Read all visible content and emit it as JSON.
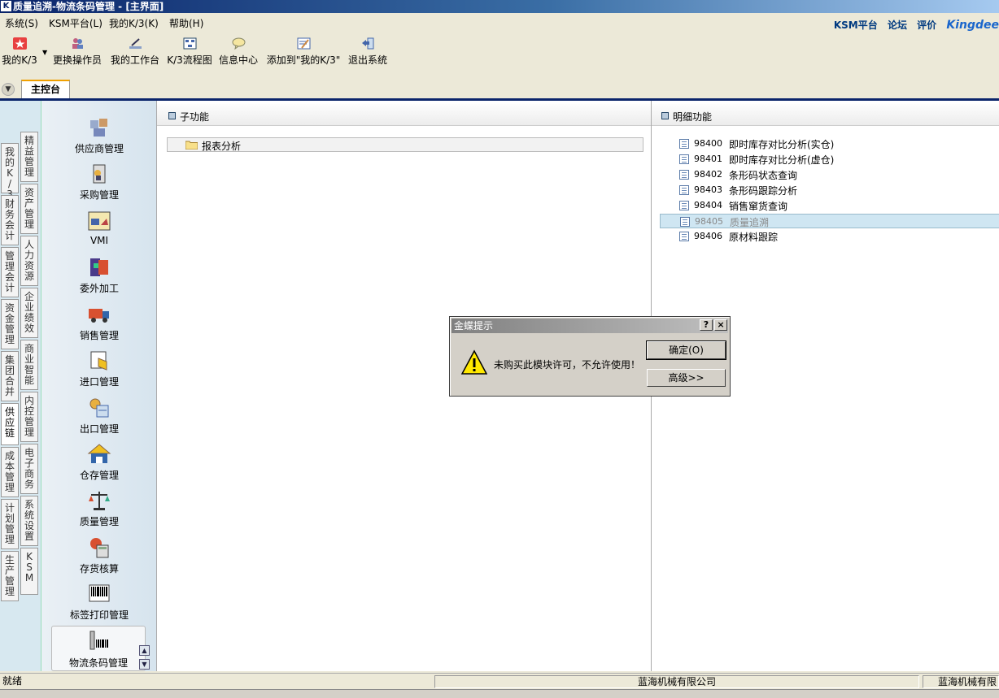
{
  "window": {
    "title": "质量追溯-物流条码管理 - [主界面]",
    "icon": "K"
  },
  "menu": {
    "items": [
      "系统(S)",
      "KSM平台(L)",
      "我的K/3(K)",
      "帮助(H)"
    ],
    "right": {
      "ksm": "KSM平台",
      "forum": "论坛",
      "rating": "评价",
      "brand": "Kingdee"
    }
  },
  "toolbar": {
    "items": [
      {
        "label": "我的K/3",
        "icon": "star-icon"
      },
      {
        "label": "更换操作员",
        "icon": "users-icon"
      },
      {
        "label": "我的工作台",
        "icon": "pen-icon"
      },
      {
        "label": "K/3流程图",
        "icon": "flowchart-icon"
      },
      {
        "label": "信息中心",
        "icon": "message-icon"
      },
      {
        "label": "添加到\"我的K/3\"",
        "icon": "add-favorite-icon"
      },
      {
        "label": "退出系统",
        "icon": "exit-icon"
      }
    ]
  },
  "tabs": {
    "main": "主控台"
  },
  "side_tabs": {
    "outer": [
      "我的K/3",
      "财务会计",
      "管理会计",
      "资金管理",
      "集团合并",
      "供应链",
      "成本管理",
      "计划管理",
      "生产管理"
    ],
    "inner": [
      "精益管理",
      "资产管理",
      "人力资源",
      "企业绩效",
      "商业智能",
      "内控管理",
      "电子商务",
      "系统设置",
      "KSM"
    ]
  },
  "modules": [
    "供应商管理",
    "采购管理",
    "VMI",
    "委外加工",
    "销售管理",
    "进口管理",
    "出口管理",
    "仓存管理",
    "质量管理",
    "存货核算",
    "标签打印管理",
    "物流条码管理"
  ],
  "sub_panel": {
    "header": "子功能",
    "folder": "报表分析"
  },
  "detail_panel": {
    "header": "明细功能",
    "items": [
      {
        "code": "98400",
        "name": "即时库存对比分析(实仓)"
      },
      {
        "code": "98401",
        "name": "即时库存对比分析(虚仓)"
      },
      {
        "code": "98402",
        "name": "条形码状态查询"
      },
      {
        "code": "98403",
        "name": "条形码跟踪分析"
      },
      {
        "code": "98404",
        "name": "销售窜货查询"
      },
      {
        "code": "98405",
        "name": "质量追溯"
      },
      {
        "code": "98406",
        "name": "原材料跟踪"
      }
    ],
    "selected_code": "98405"
  },
  "dialog": {
    "title": "金蝶提示",
    "message": "未购买此模块许可，不允许使用！",
    "ok": "确定(O)",
    "advanced": "高级>>",
    "help_glyph": "?",
    "close_glyph": "×"
  },
  "status": {
    "left": "就绪",
    "company": "蓝海机械有限公司",
    "company_right": "蓝海机械有限"
  }
}
